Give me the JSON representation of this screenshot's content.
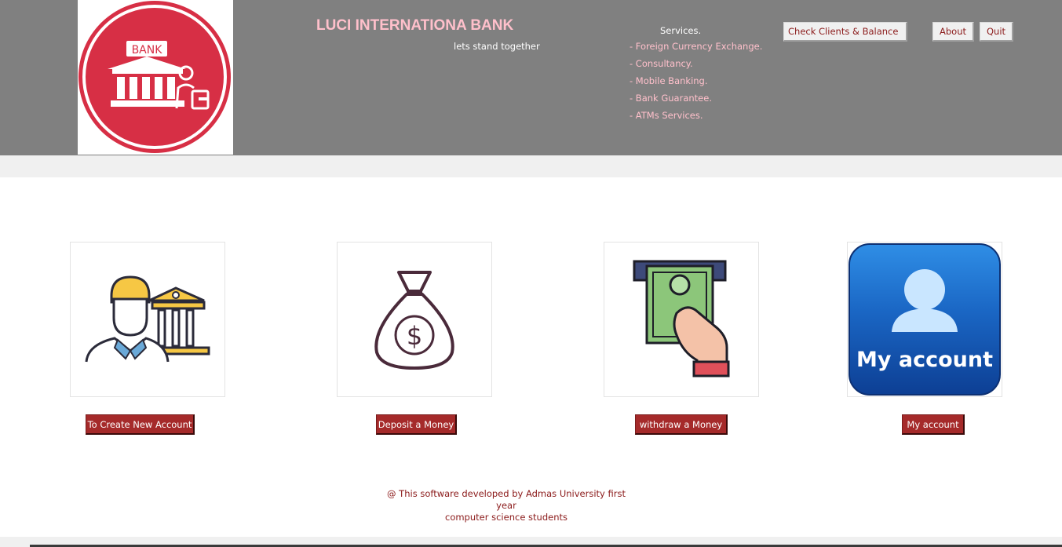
{
  "header": {
    "bank_title": "LUCI INTERNATIONA BANK",
    "tagline": "lets stand together",
    "logo_text": "BANK",
    "services_title": "Services.",
    "services": [
      "-  Foreign Currency Exchange.",
      "-  Consultancy.",
      "-  Mobile Banking.",
      "-  Bank Guarantee.",
      "-  ATMs Services."
    ],
    "buttons": {
      "check": "Check Clients & Balance",
      "about": "About",
      "quit": "Quit"
    }
  },
  "actions": [
    {
      "label": "To Create New Account",
      "icon": "customer-bank-icon"
    },
    {
      "label": "Deposit a Money",
      "icon": "money-bag-icon"
    },
    {
      "label": "withdraw a Money",
      "icon": "atm-cash-icon"
    },
    {
      "label": "My account",
      "icon": "my-account-icon",
      "icon_text": "My account"
    }
  ],
  "footer": {
    "line1": "@ This software developed by Admas University first year",
    "line2": "computer science students"
  },
  "colors": {
    "header_bg": "#808080",
    "accent_pink": "#ffc0cb",
    "button_red": "#a52a2a",
    "text_dark_red": "#8b1a1a",
    "logo_red": "#d72f45"
  }
}
